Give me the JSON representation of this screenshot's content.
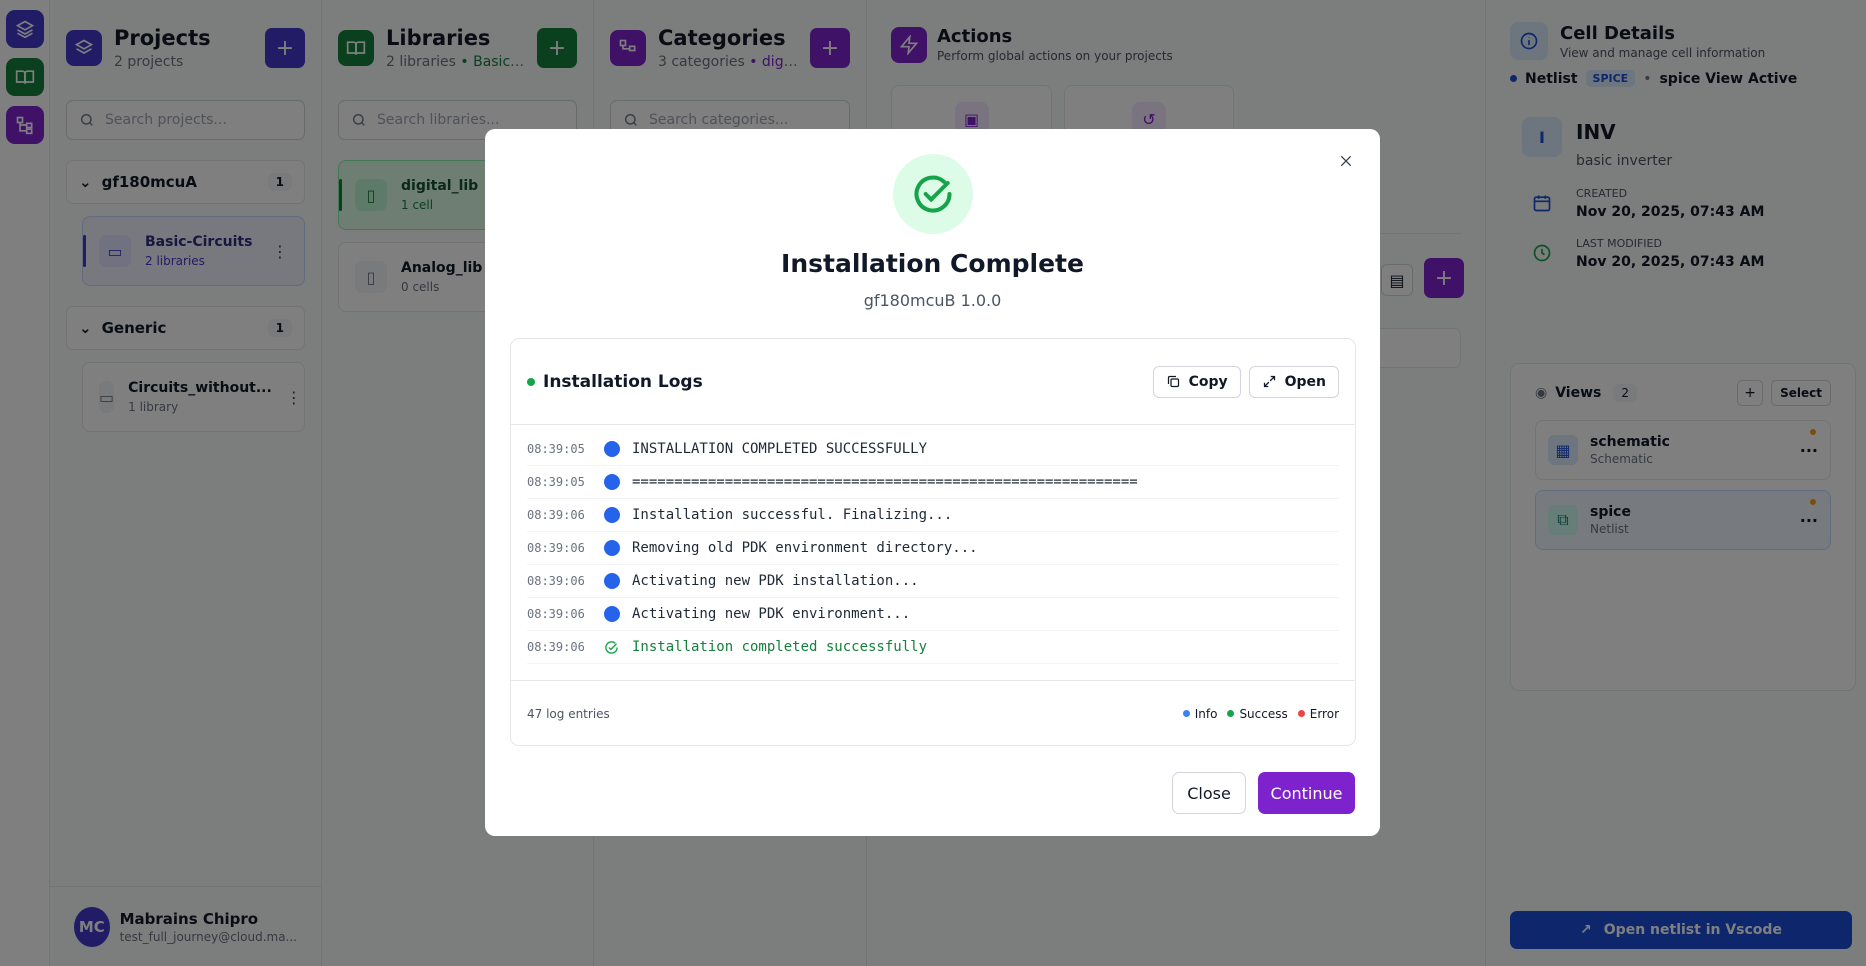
{
  "projects": {
    "title": "Projects",
    "subtitle": "2 projects",
    "search_placeholder": "Search projects...",
    "groups": [
      {
        "name": "gf180mcuA",
        "count": "1",
        "items": [
          {
            "name": "Basic-Circuits",
            "meta": "2 libraries"
          }
        ]
      },
      {
        "name": "Generic",
        "count": "1",
        "items": [
          {
            "name": "Circuits_without...",
            "meta": "1 library"
          }
        ]
      }
    ]
  },
  "libraries": {
    "title": "Libraries",
    "subtitle_count": "2 libraries",
    "subtitle_ctx": "• Basic-C...",
    "search_placeholder": "Search libraries...",
    "items": [
      {
        "name": "digital_lib",
        "meta": "1 cell"
      },
      {
        "name": "Analog_lib",
        "meta": "0 cells"
      }
    ]
  },
  "categories": {
    "title": "Categories",
    "subtitle_count": "3 categories",
    "subtitle_ctx": "• digit...",
    "search_placeholder": "Search categories..."
  },
  "actions": {
    "title": "Actions",
    "subtitle": "Perform global actions on your projects"
  },
  "cell_details": {
    "title": "Cell Details",
    "subtitle": "View and manage cell information",
    "view_type": "Netlist",
    "view_badge": "SPICE",
    "view_active": "spice View Active",
    "cell_initial": "I",
    "cell_name": "INV",
    "cell_desc": "basic inverter",
    "created_label": "CREATED",
    "created_value": "Nov 20, 2025, 07:43 AM",
    "modified_label": "LAST MODIFIED",
    "modified_value": "Nov 20, 2025, 07:43 AM",
    "views_label": "Views",
    "views_count": "2",
    "select_label": "Select",
    "views": [
      {
        "name": "schematic",
        "type": "Schematic"
      },
      {
        "name": "spice",
        "type": "Netlist"
      }
    ],
    "open_button": "Open netlist in Vscode"
  },
  "user": {
    "initials": "MC",
    "name": "Mabrains Chipro",
    "email": "test_full_journey@cloud.ma..."
  },
  "modal": {
    "title": "Installation Complete",
    "subtitle": "gf180mcuB 1.0.0",
    "logs_title": "Installation Logs",
    "copy_label": "Copy",
    "open_label": "Open",
    "log_entries": [
      {
        "time": "08:39:05",
        "level": "info",
        "message": "INSTALLATION COMPLETED SUCCESSFULLY"
      },
      {
        "time": "08:39:05",
        "level": "info",
        "message": "============================================================"
      },
      {
        "time": "08:39:06",
        "level": "info",
        "message": "Installation successful. Finalizing..."
      },
      {
        "time": "08:39:06",
        "level": "info",
        "message": "Removing old PDK environment directory..."
      },
      {
        "time": "08:39:06",
        "level": "info",
        "message": "Activating new PDK installation..."
      },
      {
        "time": "08:39:06",
        "level": "info",
        "message": "Activating new PDK environment..."
      },
      {
        "time": "08:39:06",
        "level": "success",
        "message": "Installation completed successfully"
      }
    ],
    "entries_count": "47 log entries",
    "legend": {
      "info": "Info",
      "success": "Success",
      "error": "Error"
    },
    "close_label": "Close",
    "continue_label": "Continue"
  },
  "colors": {
    "projects_accent": "#4338ca",
    "libraries_accent": "#15803d",
    "categories_accent": "#7e22ce",
    "info": "#3b82f6",
    "success": "#16a34a",
    "error": "#ef4444"
  }
}
